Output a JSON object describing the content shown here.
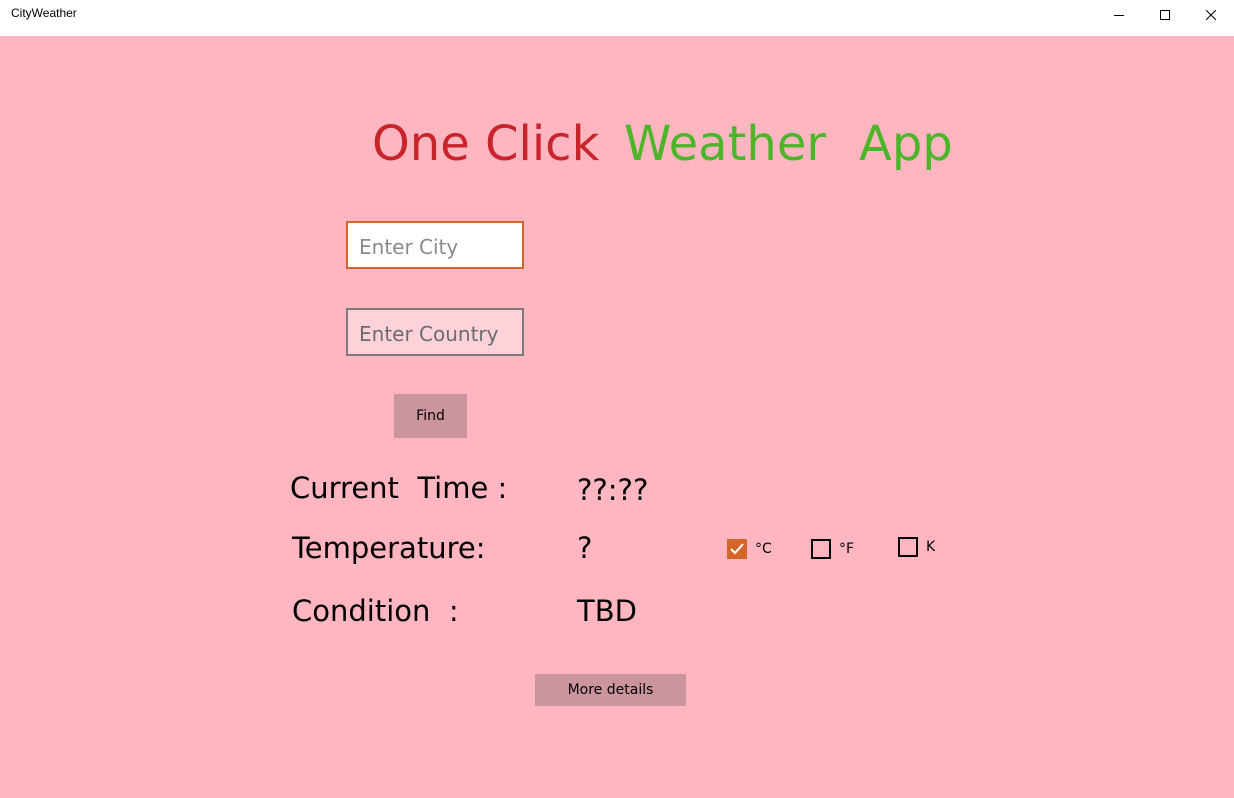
{
  "window": {
    "title": "CityWeather"
  },
  "heading": {
    "part1": "One Click",
    "part2": "Weather",
    "part3": "App"
  },
  "colors": {
    "background": "#ffb6c1",
    "heading_red": "#c8242c",
    "heading_green": "#4db52a",
    "accent": "#d4662a",
    "button": "#cc949d"
  },
  "inputs": {
    "city_placeholder": "Enter City",
    "city_value": "",
    "country_placeholder": "Enter Country",
    "country_value": ""
  },
  "buttons": {
    "find": "Find",
    "more_details": "More details"
  },
  "info": {
    "time_label": "Current  Time :",
    "time_value": "??:??",
    "temperature_label": "Temperature:",
    "temperature_value": "?",
    "condition_label": "Condition  :",
    "condition_value": "TBD"
  },
  "units": [
    {
      "label": "°C",
      "checked": true
    },
    {
      "label": "°F",
      "checked": false
    },
    {
      "label": "K",
      "checked": false
    }
  ],
  "icons": {
    "minimize": "minimize-icon",
    "maximize": "maximize-icon",
    "close": "close-icon",
    "check": "checkmark-icon"
  }
}
